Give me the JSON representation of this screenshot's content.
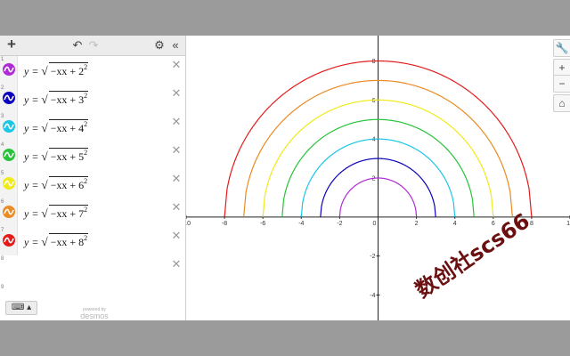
{
  "toolbar": {
    "add": "+",
    "undo": "↶",
    "redo": "↷",
    "settings": "⚙",
    "collapse": "«"
  },
  "expressions": [
    {
      "index": "1",
      "color": "#b02ad6",
      "radius": 2,
      "prefix": "y = ",
      "radicand": "−xx + 2",
      "exp": "2"
    },
    {
      "index": "2",
      "color": "#0b00bd",
      "radius": 3,
      "prefix": "y = ",
      "radicand": "−xx + 3",
      "exp": "2"
    },
    {
      "index": "3",
      "color": "#1cc6e6",
      "radius": 4,
      "prefix": "y = ",
      "radicand": "−xx + 4",
      "exp": "2"
    },
    {
      "index": "4",
      "color": "#27c43a",
      "radius": 5,
      "prefix": "y = ",
      "radicand": "−xx + 5",
      "exp": "2"
    },
    {
      "index": "5",
      "color": "#f0ea1a",
      "radius": 6,
      "prefix": "y = ",
      "radicand": "−xx + 6",
      "exp": "2"
    },
    {
      "index": "6",
      "color": "#ea8b23",
      "radius": 7,
      "prefix": "y = ",
      "radicand": "−xx + 7",
      "exp": "2"
    },
    {
      "index": "7",
      "color": "#e41b1b",
      "radius": 8,
      "prefix": "y = ",
      "radicand": "−xx + 8",
      "exp": "2"
    }
  ],
  "empty_rows": [
    {
      "index": "8"
    },
    {
      "index": "9"
    }
  ],
  "delete_glyph": "✕",
  "keyboard_button": "⌨ ▴",
  "powered_by": "powered by",
  "brand": "desmos",
  "graph": {
    "x_ticks": [
      "-10",
      "-8",
      "-6",
      "-4",
      "-2",
      "0",
      "2",
      "4",
      "6",
      "8",
      "10"
    ],
    "y_ticks": [
      "8",
      "6",
      "4",
      "2",
      "-2",
      "-4"
    ],
    "xlim": [
      -10,
      10
    ],
    "ylim": [
      -5.3,
      9.3
    ],
    "controls": {
      "wrench": "🔧",
      "zoom_in": "+",
      "zoom_out": "−",
      "home": "⌂"
    }
  },
  "watermark": "数创社scs66"
}
